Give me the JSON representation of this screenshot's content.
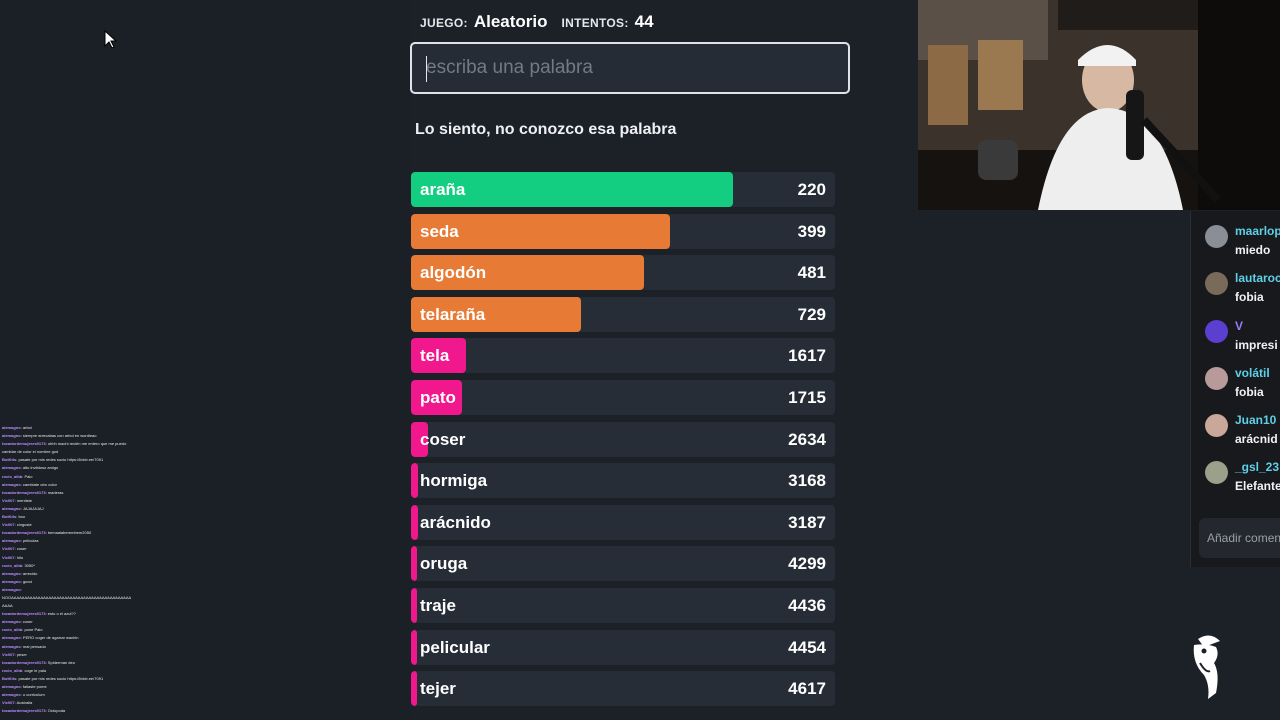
{
  "header": {
    "game_label": "JUEGO:",
    "game_value": "Aleatorio",
    "attempts_label": "INTENTOS:",
    "attempts_value": "44"
  },
  "input": {
    "placeholder": "escriba una palabra",
    "value": ""
  },
  "message": "Lo siento, no conozco esa palabra",
  "guesses": [
    {
      "word": "araña",
      "rank": "220",
      "color": "#13ce80",
      "fill": 0.76
    },
    {
      "word": "seda",
      "rank": "399",
      "color": "#e77b35",
      "fill": 0.61
    },
    {
      "word": "algodón",
      "rank": "481",
      "color": "#e77b35",
      "fill": 0.55
    },
    {
      "word": "telaraña",
      "rank": "729",
      "color": "#e77b35",
      "fill": 0.4
    },
    {
      "word": "tela",
      "rank": "1617",
      "color": "#f0188c",
      "fill": 0.13
    },
    {
      "word": "pato",
      "rank": "1715",
      "color": "#f0188c",
      "fill": 0.12
    },
    {
      "word": "coser",
      "rank": "2634",
      "color": "#f0188c",
      "fill": 0.04
    },
    {
      "word": "hormiga",
      "rank": "3168",
      "color": "#f0188c",
      "fill": 0.016
    },
    {
      "word": "arácnido",
      "rank": "3187",
      "color": "#f0188c",
      "fill": 0.016
    },
    {
      "word": "oruga",
      "rank": "4299",
      "color": "#f0188c",
      "fill": 0.014
    },
    {
      "word": "traje",
      "rank": "4436",
      "color": "#f0188c",
      "fill": 0.014
    },
    {
      "word": "pelicular",
      "rank": "4454",
      "color": "#f0188c",
      "fill": 0.014
    },
    {
      "word": "tejer",
      "rank": "4617",
      "color": "#f0188c",
      "fill": 0.014
    }
  ],
  "chat": {
    "messages": [
      {
        "user": "maarlop",
        "text": "miedo",
        "user_color": "#5fd0e8",
        "avatar_color": "#8a8f96"
      },
      {
        "user": "lautaroc",
        "text": "fobia",
        "user_color": "#5fd0e8",
        "avatar_color": "#7a6a5a"
      },
      {
        "user": "V",
        "text": "impresi",
        "user_color": "#9b7bff",
        "avatar_color": "#5b3fd1"
      },
      {
        "user": "volátil",
        "text": "fobia",
        "user_color": "#5fd0e8",
        "avatar_color": "#b89a9a"
      },
      {
        "user": "Juan10",
        "text": "arácnid",
        "user_color": "#5fd0e8",
        "avatar_color": "#c9a89a"
      },
      {
        "user": "_gsl_23",
        "text": "Elefante",
        "user_color": "#5fd0e8",
        "avatar_color": "#9aa08a"
      }
    ],
    "input_placeholder": "Añadir comen"
  },
  "mini_chat": [
    {
      "u": "alemagno",
      "t": ": arbol"
    },
    {
      "u": "alemagno",
      "t": ": siempre arrecabas con arbol en wordleao"
    },
    {
      "u": "tocadordemujeres9173",
      "t": ": uhhh machi recién me entero que me puedo"
    },
    {
      "u": "",
      "t": "cambiar de color el nombre god"
    },
    {
      "u": "BotKits",
      "t": ": pasate por mis redes socio https://linktr.ee/7091"
    },
    {
      "u": "alemagno",
      "t": ": alto invitdoso amigo"
    },
    {
      "u": "rocio_albb",
      "t": ": Palo"
    },
    {
      "u": "alemagno",
      "t": ": cambiate otro color"
    },
    {
      "u": "tocadordemujeres9173",
      "t": ": maderas"
    },
    {
      "u": "Vic007",
      "t": ": mentiste"
    },
    {
      "u": "alemagno",
      "t": ": JAJAJAJAJ"
    },
    {
      "u": "BotKits",
      "t": ": boo"
    },
    {
      "u": "Vic007",
      "t": ": cinguste"
    },
    {
      "u": "tocadordemujeres9173",
      "t": ": bemaalaberembem2050"
    },
    {
      "u": "alemagno",
      "t": ": peliculas"
    },
    {
      "u": "Vic007",
      "t": ": coser"
    },
    {
      "u": "Vic007",
      "t": ": hilo"
    },
    {
      "u": "rocio_albb",
      "t": ": 3050*"
    },
    {
      "u": "alemagno",
      "t": ": arrecido"
    },
    {
      "u": "alemagno",
      "t": ": gucci"
    },
    {
      "u": "alemagno",
      "t": ":"
    },
    {
      "u": "",
      "t": "NOOAAAAAAAAAAAAAAAAAAAAAAAAAAAAAAAAAAAAAAAAAAAAA"
    },
    {
      "u": "",
      "t": "AAAA"
    },
    {
      "u": "tocadordemujeres9173",
      "t": ": esto o el azul??"
    },
    {
      "u": "alemagno",
      "t": ": coser"
    },
    {
      "u": "rocio_albb",
      "t": ": pone Palo"
    },
    {
      "u": "alemagno",
      "t": ": PERO coger de agarrar wachin"
    },
    {
      "u": "alemagno",
      "t": ": mal pensado"
    },
    {
      "u": "Vic007",
      "t": ": peser"
    },
    {
      "u": "tocadordemujeres9173",
      "t": ": Spiderman deo"
    },
    {
      "u": "rocio_albb",
      "t": ": coge le pala"
    },
    {
      "u": "BotKits",
      "t": ": pasate por mis redes socio https://linktr.ee/7091"
    },
    {
      "u": "alemagno",
      "t": ": fallaste pome"
    },
    {
      "u": "alemagno",
      "t": ": o curriculum"
    },
    {
      "u": "Vic007",
      "t": ": Australia"
    },
    {
      "u": "tocadordemujeres9173",
      "t": ": Octopoda"
    }
  ]
}
